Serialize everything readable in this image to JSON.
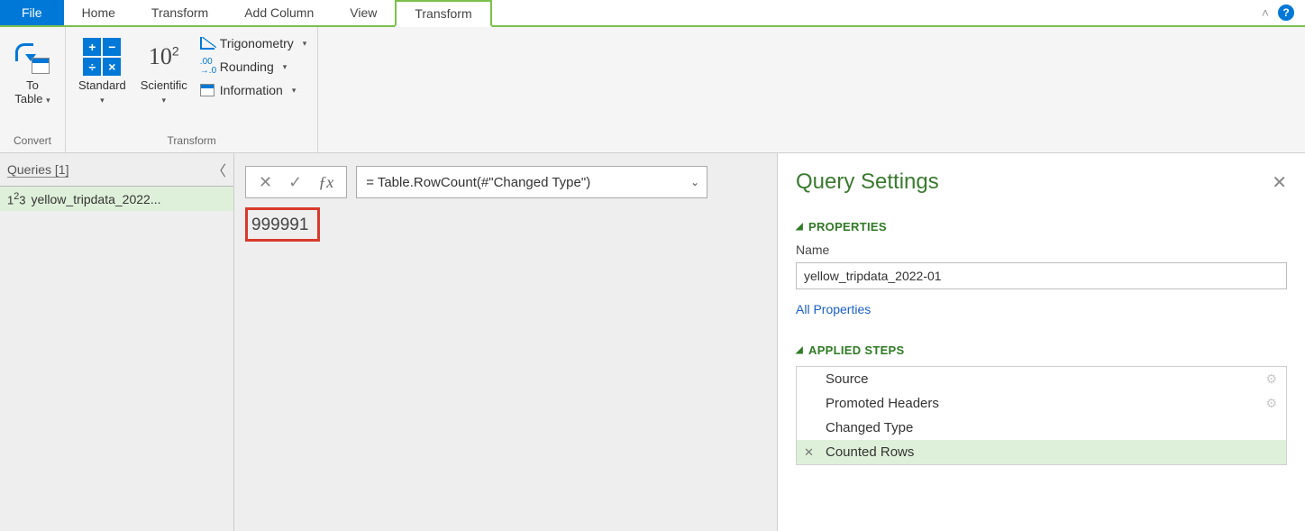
{
  "tabs": {
    "file": "File",
    "home": "Home",
    "transform1": "Transform",
    "addcolumn": "Add Column",
    "view": "View",
    "transform_active": "Transform"
  },
  "ribbon": {
    "convert_group": "Convert",
    "transform_group": "Transform",
    "to_table_label": "To\nTable",
    "standard_label": "Standard",
    "scientific_label": "Scientific",
    "trig_label": "Trigonometry",
    "rounding_label": "Rounding",
    "information_label": "Information"
  },
  "queries": {
    "header": "Queries [1]",
    "item1": "yellow_tripdata_2022..."
  },
  "formula": {
    "text": "= Table.RowCount(#\"Changed Type\")"
  },
  "result": "999991",
  "settings": {
    "title": "Query Settings",
    "properties_label": "PROPERTIES",
    "name_label": "Name",
    "name_value": "yellow_tripdata_2022-01",
    "all_properties": "All Properties",
    "applied_steps_label": "APPLIED STEPS",
    "steps": {
      "s1": "Source",
      "s2": "Promoted Headers",
      "s3": "Changed Type",
      "s4": "Counted Rows"
    }
  }
}
